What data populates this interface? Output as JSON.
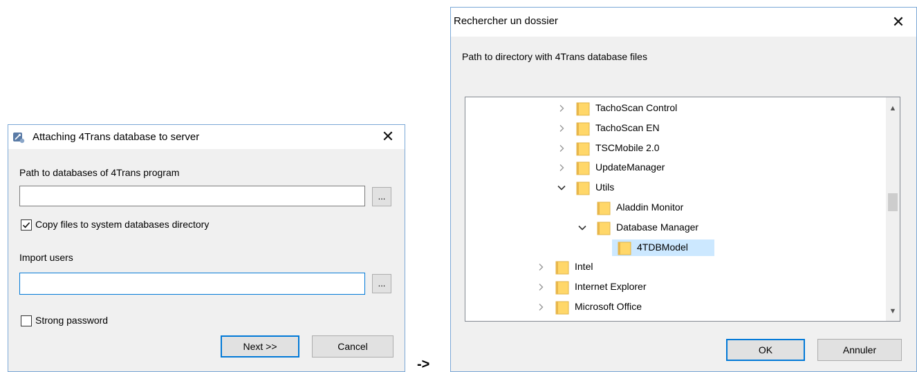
{
  "attach_dialog": {
    "title": "Attaching 4Trans database to server",
    "path_label": "Path to databases of 4Trans program",
    "path_value": "",
    "browse_label": "...",
    "copy_files_label": "Copy files to system databases directory",
    "copy_files_checked": true,
    "import_users_label": "Import users",
    "import_users_value": "",
    "strong_password_label": "Strong password",
    "strong_password_checked": false,
    "next_label": "Next >>",
    "cancel_label": "Cancel"
  },
  "arrow": "->",
  "folder_dialog": {
    "title": "Rechercher un dossier",
    "description": "Path to directory with 4Trans database files",
    "tree_items": [
      {
        "label": "TachoScan Control",
        "level": 1,
        "expanded": false,
        "has_children": true
      },
      {
        "label": "TachoScan EN",
        "level": 1,
        "expanded": false,
        "has_children": true
      },
      {
        "label": "TSCMobile 2.0",
        "level": 1,
        "expanded": false,
        "has_children": true
      },
      {
        "label": "UpdateManager",
        "level": 1,
        "expanded": false,
        "has_children": true
      },
      {
        "label": "Utils",
        "level": 1,
        "expanded": true,
        "has_children": true
      },
      {
        "label": "Aladdin Monitor",
        "level": 2,
        "expanded": false,
        "has_children": false
      },
      {
        "label": "Database Manager",
        "level": 2,
        "expanded": true,
        "has_children": true
      },
      {
        "label": "4TDBModel",
        "level": 3,
        "expanded": false,
        "has_children": false,
        "selected": true
      },
      {
        "label": "Intel",
        "level": 0,
        "expanded": false,
        "has_children": true
      },
      {
        "label": "Internet Explorer",
        "level": 0,
        "expanded": false,
        "has_children": true
      },
      {
        "label": "Microsoft Office",
        "level": 0,
        "expanded": false,
        "has_children": true
      }
    ],
    "ok_label": "OK",
    "cancel_label": "Annuler"
  },
  "colors": {
    "accent": "#0078d7",
    "selection": "#cce8ff",
    "folder": "#ffd769"
  },
  "icons": {
    "app": "database-connect-icon",
    "close": "close-icon",
    "folder": "folder-icon",
    "chevron_right": "chevron-right-icon",
    "chevron_down": "chevron-down-icon"
  }
}
